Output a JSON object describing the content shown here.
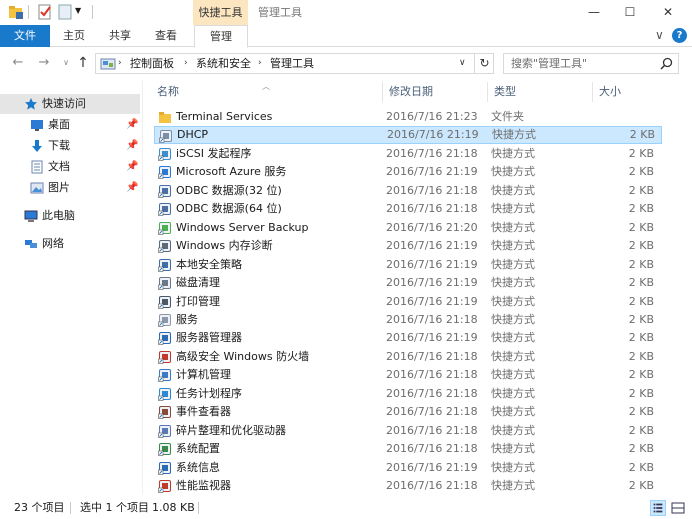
{
  "titlebar": {
    "context_tab": "快捷工具",
    "title": "管理工具",
    "minimize": "—",
    "maximize": "☐",
    "close": "✕"
  },
  "ribbon": {
    "tabs": [
      "文件",
      "主页",
      "共享",
      "查看",
      "管理"
    ],
    "collapse_caret": "∨",
    "help": "?"
  },
  "address": {
    "breadcrumbs": [
      "控制面板",
      "系统和安全",
      "管理工具"
    ],
    "search_placeholder": "搜索\"管理工具\""
  },
  "sidebar": {
    "quick_access": "快速访问",
    "pinned": [
      "桌面",
      "下载",
      "文档",
      "图片"
    ],
    "this_pc": "此电脑",
    "network": "网络"
  },
  "columns": {
    "name": "名称",
    "date": "修改日期",
    "type": "类型",
    "size": "大小"
  },
  "files": [
    {
      "name": "Terminal Services",
      "date": "2016/7/16 21:23",
      "type": "文件夹",
      "size": "",
      "icon": "folder-icon"
    },
    {
      "name": "DHCP",
      "date": "2016/7/16 21:19",
      "type": "快捷方式",
      "size": "2 KB",
      "icon": "dhcp-icon"
    },
    {
      "name": "iSCSI 发起程序",
      "date": "2016/7/16 21:18",
      "type": "快捷方式",
      "size": "2 KB",
      "icon": "iscsi-icon"
    },
    {
      "name": "Microsoft Azure 服务",
      "date": "2016/7/16 21:19",
      "type": "快捷方式",
      "size": "2 KB",
      "icon": "azure-icon"
    },
    {
      "name": "ODBC 数据源(32 位)",
      "date": "2016/7/16 21:18",
      "type": "快捷方式",
      "size": "2 KB",
      "icon": "odbc-icon"
    },
    {
      "name": "ODBC 数据源(64 位)",
      "date": "2016/7/16 21:18",
      "type": "快捷方式",
      "size": "2 KB",
      "icon": "odbc-icon"
    },
    {
      "name": "Windows Server Backup",
      "date": "2016/7/16 21:20",
      "type": "快捷方式",
      "size": "2 KB",
      "icon": "backup-icon"
    },
    {
      "name": "Windows 内存诊断",
      "date": "2016/7/16 21:19",
      "type": "快捷方式",
      "size": "2 KB",
      "icon": "memory-icon"
    },
    {
      "name": "本地安全策略",
      "date": "2016/7/16 21:19",
      "type": "快捷方式",
      "size": "2 KB",
      "icon": "security-policy-icon"
    },
    {
      "name": "磁盘清理",
      "date": "2016/7/16 21:19",
      "type": "快捷方式",
      "size": "2 KB",
      "icon": "disk-cleanup-icon"
    },
    {
      "name": "打印管理",
      "date": "2016/7/16 21:19",
      "type": "快捷方式",
      "size": "2 KB",
      "icon": "printer-icon"
    },
    {
      "name": "服务",
      "date": "2016/7/16 21:18",
      "type": "快捷方式",
      "size": "2 KB",
      "icon": "services-icon"
    },
    {
      "name": "服务器管理器",
      "date": "2016/7/16 21:19",
      "type": "快捷方式",
      "size": "2 KB",
      "icon": "server-manager-icon"
    },
    {
      "name": "高级安全 Windows 防火墙",
      "date": "2016/7/16 21:18",
      "type": "快捷方式",
      "size": "2 KB",
      "icon": "firewall-icon"
    },
    {
      "name": "计算机管理",
      "date": "2016/7/16 21:18",
      "type": "快捷方式",
      "size": "2 KB",
      "icon": "computer-management-icon"
    },
    {
      "name": "任务计划程序",
      "date": "2016/7/16 21:18",
      "type": "快捷方式",
      "size": "2 KB",
      "icon": "task-scheduler-icon"
    },
    {
      "name": "事件查看器",
      "date": "2016/7/16 21:18",
      "type": "快捷方式",
      "size": "2 KB",
      "icon": "event-viewer-icon"
    },
    {
      "name": "碎片整理和优化驱动器",
      "date": "2016/7/16 21:18",
      "type": "快捷方式",
      "size": "2 KB",
      "icon": "defrag-icon"
    },
    {
      "name": "系统配置",
      "date": "2016/7/16 21:18",
      "type": "快捷方式",
      "size": "2 KB",
      "icon": "system-config-icon"
    },
    {
      "name": "系统信息",
      "date": "2016/7/16 21:19",
      "type": "快捷方式",
      "size": "2 KB",
      "icon": "system-info-icon"
    },
    {
      "name": "性能监视器",
      "date": "2016/7/16 21:18",
      "type": "快捷方式",
      "size": "2 KB",
      "icon": "performance-icon"
    }
  ],
  "selected_file": "DHCP",
  "status": {
    "item_count": "23 个项目",
    "selection": "选中 1 个项目",
    "selection_size": "1.08 KB"
  },
  "colors": {
    "accent": "#1979ca",
    "context_tab": "#fbe6c0",
    "selection": "#cce8ff",
    "selection_border": "#99d1ff",
    "folder": "#f5c342"
  }
}
